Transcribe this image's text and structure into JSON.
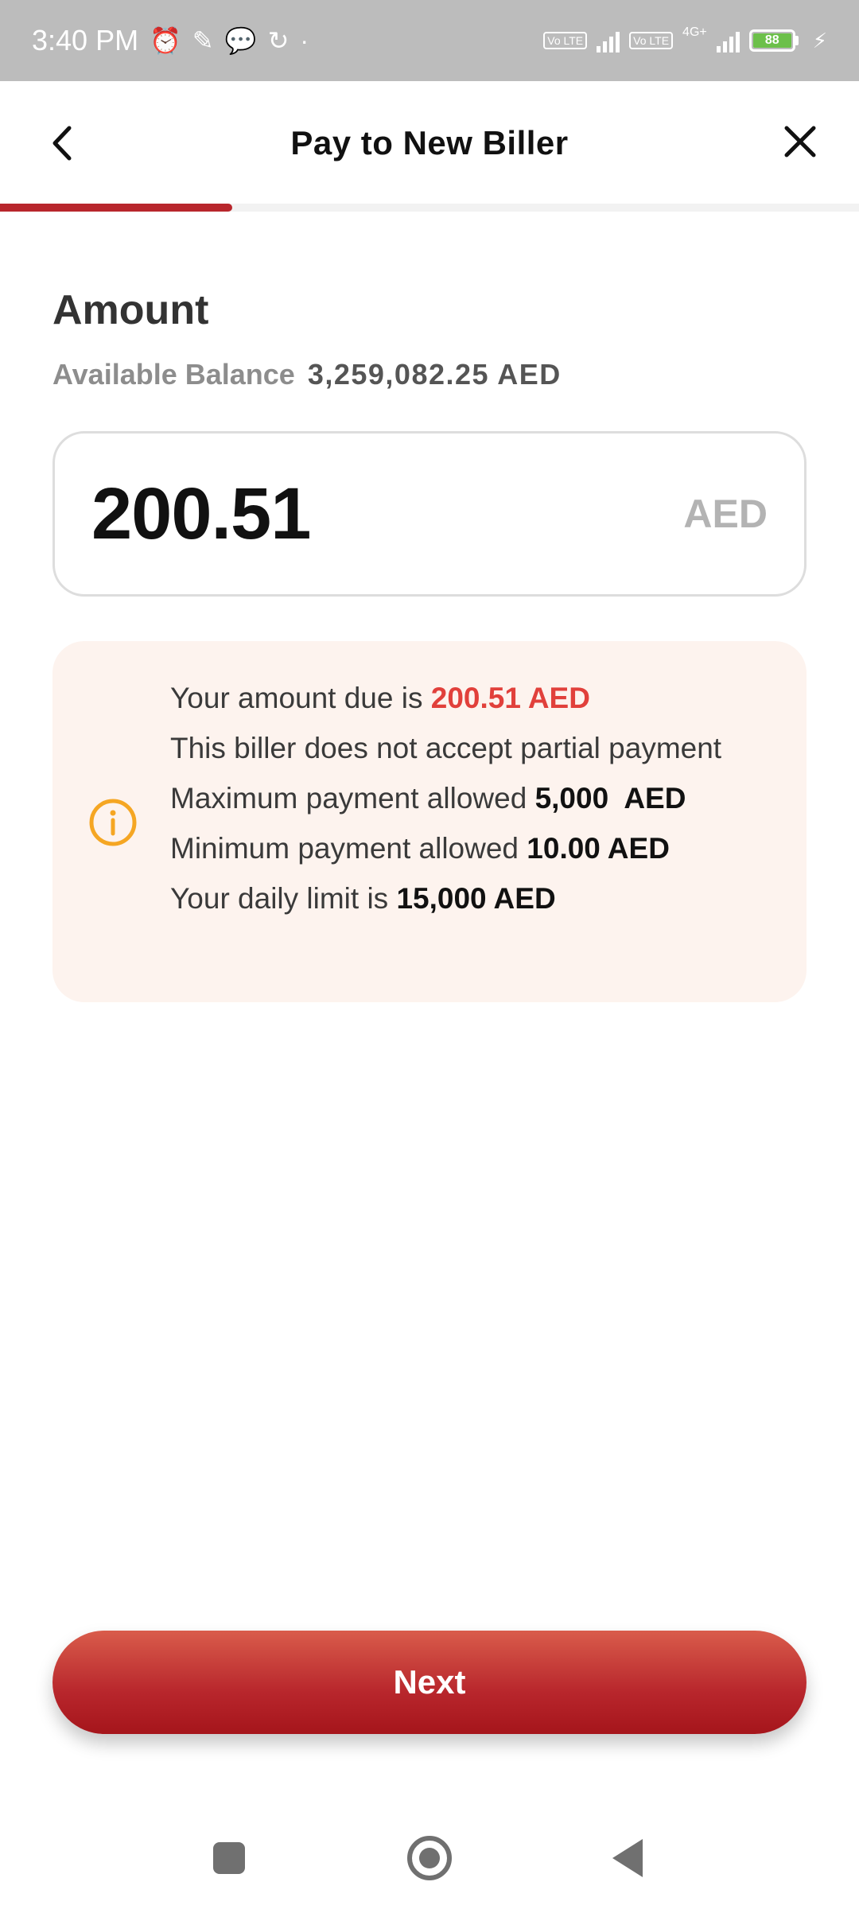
{
  "status_bar": {
    "time": "3:40 PM",
    "net_type": "4G+",
    "volte_1": "Vo LTE",
    "volte_2": "Vo LTE",
    "battery": "88"
  },
  "header": {
    "title": "Pay to New Biller"
  },
  "progress": {
    "fraction": 0.25
  },
  "amount_section": {
    "title": "Amount",
    "balance_label": "Available Balance",
    "balance_value": "3,259,082.25 AED"
  },
  "amount_input": {
    "value": "200.51",
    "currency": "AED"
  },
  "info": {
    "due_prefix": "Your amount due is ",
    "due_value": "200.51 AED",
    "partial_text": "This biller does not accept partial payment",
    "max_prefix": "Maximum payment allowed ",
    "max_value": "5,000  AED",
    "min_prefix": "Minimum payment allowed ",
    "min_value": "10.00 AED",
    "daily_prefix": "Your daily limit is ",
    "daily_value": "15,000 AED"
  },
  "actions": {
    "next_label": "Next"
  },
  "colors": {
    "brand_red": "#b8262c",
    "highlight_red": "#e1403b",
    "info_bg": "#fdf3ee",
    "info_icon": "#f5a623"
  },
  "icons": {
    "back": "chevron-left-icon",
    "close": "close-icon",
    "info": "info-circle-icon"
  }
}
